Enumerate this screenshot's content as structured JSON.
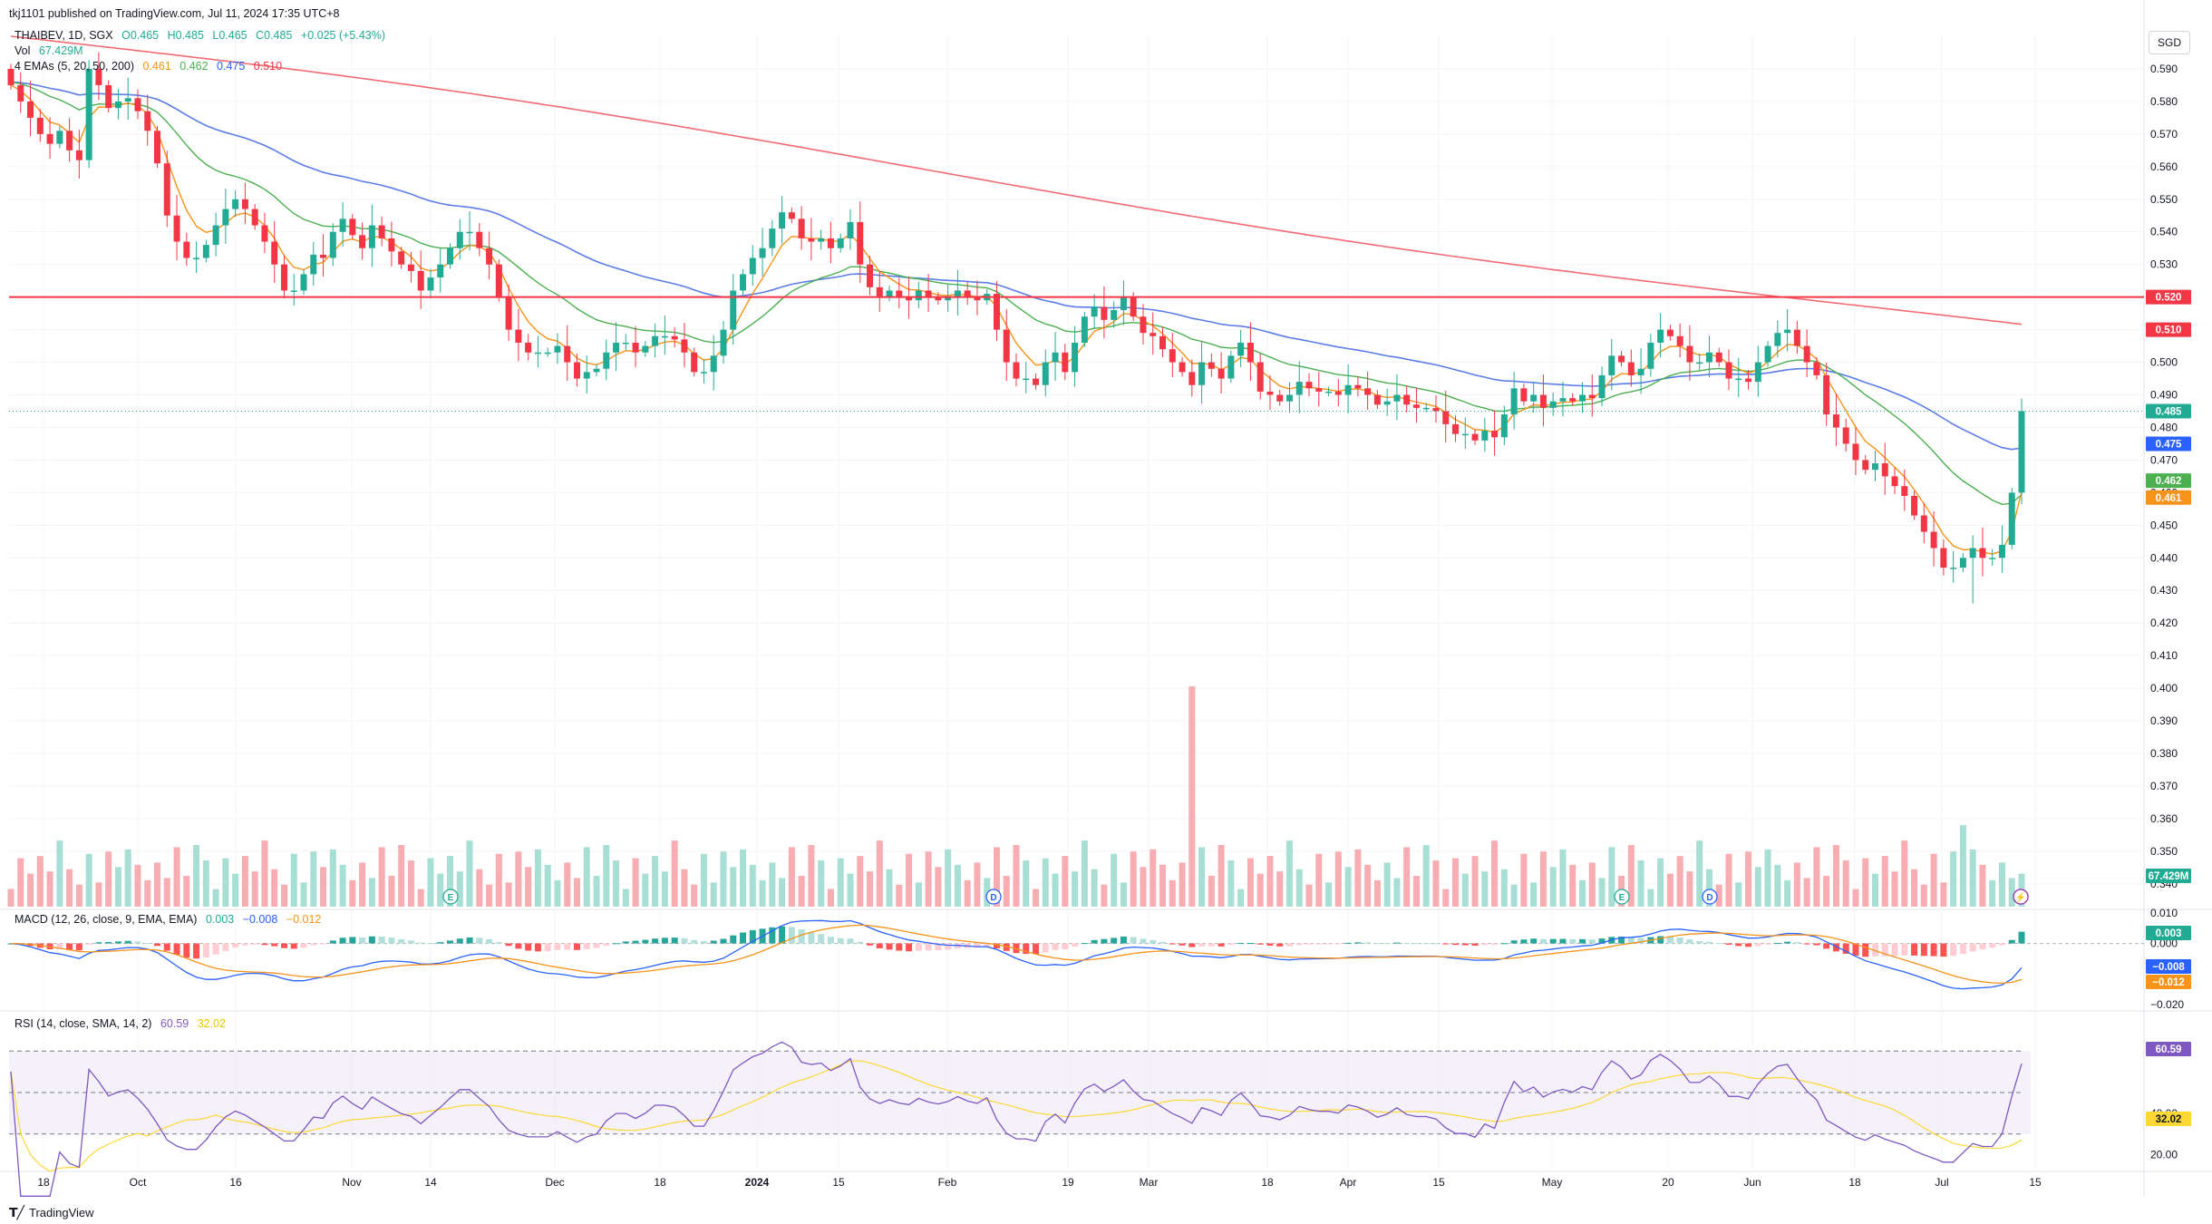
{
  "header": {
    "published": "tkj1101 published on TradingView.com, Jul 11, 2024 17:35 UTC+8",
    "symbol": "THAIBEV, 1D, SGX",
    "ohlc": [
      "O0.465",
      "H0.485",
      "L0.465",
      "C0.485",
      "+0.025 (+5.43%)"
    ],
    "vol_label": "Vol",
    "vol_value": "67.429M",
    "emas_label": "4 EMAs (5, 20, 50, 200)",
    "emas_values": [
      "0.461",
      "0.462",
      "0.475",
      "0.510"
    ],
    "macd_label": "MACD (12, 26, close, 9, EMA, EMA)",
    "macd_values": [
      "0.003",
      "−0.008",
      "−0.012"
    ],
    "rsi_label": "RSI (14, close, SMA, 14, 2)",
    "rsi_values": [
      "60.59",
      "32.02"
    ]
  },
  "currency": "SGD",
  "brand": "TradingView",
  "colors": {
    "up": "#22ab94",
    "down": "#f23645",
    "ema5": "#f7931a",
    "ema20": "#4caf50",
    "ema50": "#5b7de8",
    "ema200": "#f26b72",
    "rsi": "#7e57c2",
    "rsi_ma": "#fdd835"
  },
  "chart_data": [
    {
      "type": "candlestick",
      "pane": "price",
      "title": "THAIBEV, 1D, SGX",
      "unit": "SGD",
      "ylim": [
        0.415,
        0.6
      ],
      "yticks": [
        "0.590",
        "0.580",
        "0.570",
        "0.560",
        "0.550",
        "0.540",
        "0.530",
        "0.520",
        "0.510",
        "0.500",
        "0.490",
        "0.480",
        "0.470",
        "0.460",
        "0.450",
        "0.440",
        "0.430",
        "0.420",
        "0.410",
        "0.400",
        "0.390",
        "0.380",
        "0.370",
        "0.360",
        "0.350",
        "0.340"
      ],
      "x_labels": [
        "18",
        "Oct",
        "16",
        "Nov",
        "14",
        "Dec",
        "18",
        "2024",
        "15",
        "Feb",
        "19",
        "Mar",
        "18",
        "Apr",
        "15",
        "May",
        "20",
        "Jun",
        "18",
        "Jul",
        "15"
      ],
      "close": [
        0.585,
        0.58,
        0.575,
        0.57,
        0.567,
        0.571,
        0.565,
        0.562,
        0.59,
        0.585,
        0.578,
        0.58,
        0.581,
        0.577,
        0.571,
        0.561,
        0.545,
        0.537,
        0.532,
        0.532,
        0.536,
        0.542,
        0.547,
        0.55,
        0.547,
        0.542,
        0.537,
        0.53,
        0.522,
        0.522,
        0.527,
        0.533,
        0.532,
        0.54,
        0.544,
        0.539,
        0.535,
        0.542,
        0.538,
        0.534,
        0.53,
        0.528,
        0.522,
        0.526,
        0.53,
        0.535,
        0.54,
        0.54,
        0.535,
        0.53,
        0.52,
        0.51,
        0.506,
        0.503,
        0.503,
        0.503,
        0.505,
        0.5,
        0.495,
        0.497,
        0.498,
        0.503,
        0.506,
        0.506,
        0.503,
        0.505,
        0.508,
        0.508,
        0.507,
        0.503,
        0.497,
        0.497,
        0.502,
        0.51,
        0.522,
        0.527,
        0.532,
        0.535,
        0.541,
        0.546,
        0.544,
        0.538,
        0.537,
        0.538,
        0.535,
        0.538,
        0.543,
        0.53,
        0.523,
        0.52,
        0.522,
        0.52,
        0.519,
        0.522,
        0.52,
        0.519,
        0.52,
        0.522,
        0.52,
        0.519,
        0.521,
        0.51,
        0.5,
        0.495,
        0.495,
        0.493,
        0.5,
        0.503,
        0.497,
        0.506,
        0.514,
        0.517,
        0.513,
        0.516,
        0.52,
        0.514,
        0.509,
        0.508,
        0.504,
        0.5,
        0.497,
        0.493,
        0.5,
        0.498,
        0.495,
        0.502,
        0.506,
        0.5,
        0.491,
        0.49,
        0.488,
        0.49,
        0.494,
        0.492,
        0.491,
        0.491,
        0.49,
        0.493,
        0.492,
        0.49,
        0.487,
        0.488,
        0.49,
        0.487,
        0.486,
        0.486,
        0.485,
        0.481,
        0.478,
        0.478,
        0.476,
        0.479,
        0.477,
        0.484,
        0.492,
        0.488,
        0.49,
        0.486,
        0.488,
        0.489,
        0.488,
        0.49,
        0.489,
        0.496,
        0.502,
        0.5,
        0.496,
        0.498,
        0.506,
        0.51,
        0.508,
        0.505,
        0.5,
        0.5,
        0.503,
        0.5,
        0.495,
        0.495,
        0.494,
        0.5,
        0.505,
        0.509,
        0.51,
        0.505,
        0.5,
        0.496,
        0.484,
        0.48,
        0.475,
        0.47,
        0.467,
        0.469,
        0.465,
        0.462,
        0.459,
        0.453,
        0.448,
        0.443,
        0.437,
        0.437,
        0.44,
        0.443,
        0.44,
        0.44,
        0.444,
        0.46,
        0.485
      ],
      "series": [
        {
          "name": "EMA 5",
          "last": 0.461
        },
        {
          "name": "EMA 20",
          "last": 0.462
        },
        {
          "name": "EMA 50",
          "last": 0.475
        },
        {
          "name": "EMA 200",
          "last": 0.51
        }
      ],
      "hline": 0.52,
      "price_badges": [
        {
          "label": "0.520",
          "value": 0.52,
          "color": "#f23645"
        },
        {
          "label": "0.510",
          "value": 0.51,
          "color": "#f23645"
        },
        {
          "label": "0.485",
          "value": 0.485,
          "color": "#22ab94"
        },
        {
          "label": "0.475",
          "value": 0.475,
          "color": "#2962ff"
        },
        {
          "label": "0.462",
          "value": 0.462,
          "color": "#4caf50"
        },
        {
          "label": "0.461",
          "value": 0.461,
          "color": "#f7931a"
        }
      ]
    },
    {
      "type": "bar",
      "pane": "volume",
      "name": "Vol",
      "last": "67.429M",
      "badge": "67.429M",
      "spikes": [
        {
          "date": "Mar 18",
          "rel": 1.0
        },
        {
          "date": "Jul",
          "rel": 0.37
        }
      ]
    },
    {
      "type": "line",
      "pane": "macd",
      "ylim": [
        -0.022,
        0.012
      ],
      "yticks": [
        "0.010",
        "0.000",
        "−0.020"
      ],
      "last": {
        "histogram": 0.003,
        "macd": -0.008,
        "signal": -0.012
      },
      "badges": [
        {
          "label": "0.003",
          "value": 0.003,
          "color": "#22ab94"
        },
        {
          "label": "−0.008",
          "value": -0.008,
          "color": "#2962ff"
        },
        {
          "label": "−0.012",
          "value": -0.012,
          "color": "#f7931a"
        }
      ]
    },
    {
      "type": "line",
      "pane": "rsi",
      "ylim": [
        15,
        85
      ],
      "bands": [
        70,
        50,
        30
      ],
      "yticks": [
        "40.00",
        "20.00"
      ],
      "last": {
        "rsi": 60.59,
        "ma": 32.02
      },
      "badges": [
        {
          "label": "60.59",
          "value": 60.59,
          "color": "#7e57c2"
        },
        {
          "label": "32.02",
          "value": 32.02,
          "color": "#fdd835"
        }
      ]
    }
  ]
}
